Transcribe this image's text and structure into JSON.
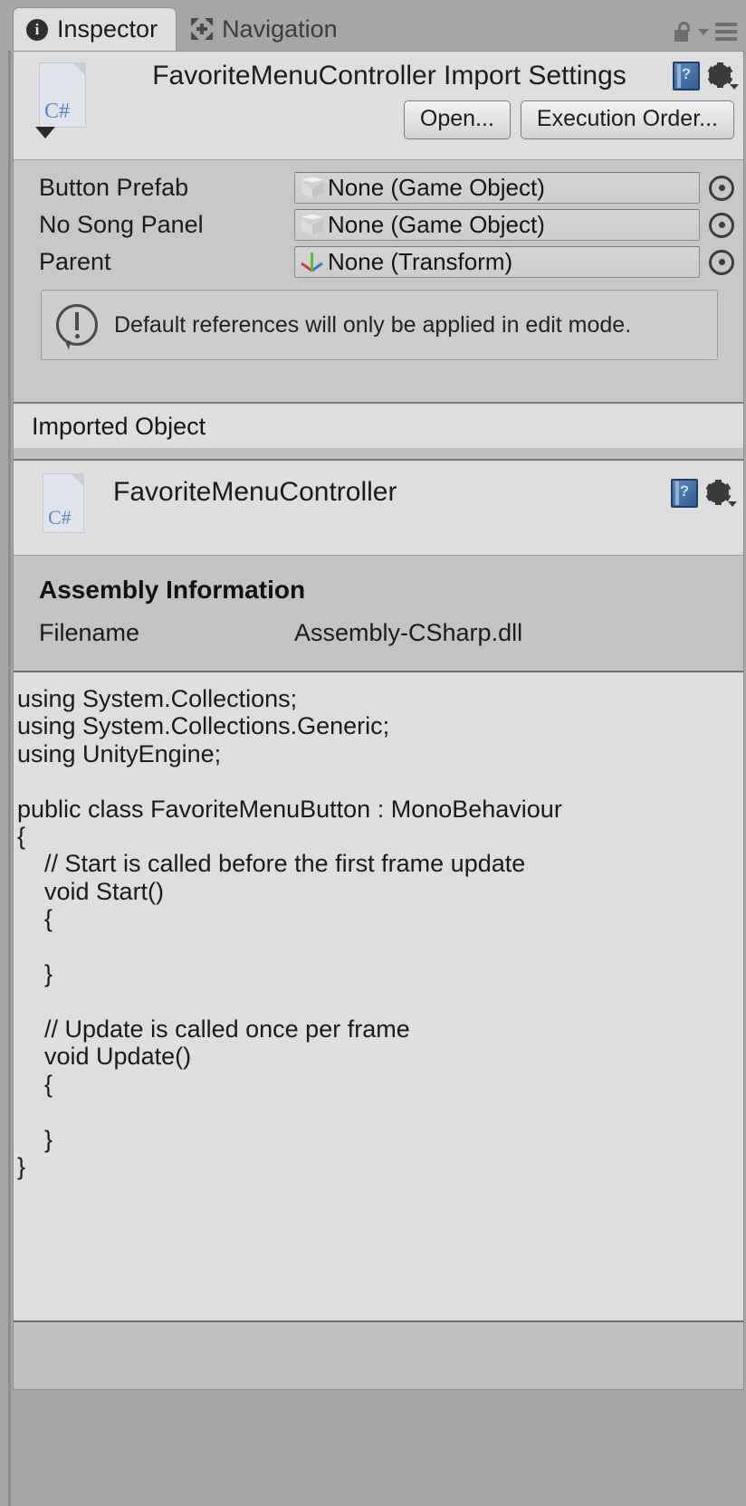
{
  "tabs": [
    {
      "label": "Inspector",
      "icon": "info-circle-icon",
      "active": true
    },
    {
      "label": "Navigation",
      "icon": "four-arrows-icon",
      "active": false
    }
  ],
  "window_controls": {
    "lock_icon": "lock-open-icon",
    "menu_caret_icon": "caret-down-icon",
    "menu_icon": "hamburger-menu-icon"
  },
  "import_settings": {
    "file_icon": "csharp-file-icon",
    "file_icon_label": "C#",
    "expand_caret_icon": "caret-down-icon",
    "title": "FavoriteMenuController Import Settings",
    "help_icon": "help-book-icon",
    "gear_icon": "gear-icon",
    "buttons": [
      {
        "label": "Open..."
      },
      {
        "label": "Execution Order..."
      }
    ]
  },
  "properties": [
    {
      "label": "Button Prefab",
      "value": "None (Game Object)",
      "value_icon": "game-object-cube-icon",
      "picker_icon": "circle-select-icon"
    },
    {
      "label": "No Song Panel",
      "value": "None (Game Object)",
      "value_icon": "game-object-cube-icon",
      "picker_icon": "circle-select-icon"
    },
    {
      "label": "Parent",
      "value": "None (Transform)",
      "value_icon": "transform-gizmo-icon",
      "picker_icon": "circle-select-icon"
    }
  ],
  "help_box": {
    "icon": "info-warning-icon",
    "message": "Default references will only be applied in edit mode."
  },
  "imported_object": {
    "section_title": "Imported Object",
    "file_icon": "csharp-file-icon",
    "file_icon_label": "C#",
    "name": "FavoriteMenuController",
    "help_icon": "help-book-icon",
    "gear_icon": "gear-icon"
  },
  "assembly_information": {
    "heading": "Assembly Information",
    "rows": [
      {
        "key": "Filename",
        "value": "Assembly-CSharp.dll"
      }
    ]
  },
  "code_preview": {
    "text": "using System.Collections;\nusing System.Collections.Generic;\nusing UnityEngine;\n\npublic class FavoriteMenuButton : MonoBehaviour\n{\n    // Start is called before the first frame update\n    void Start()\n    {\n        \n    }\n\n    // Update is called once per frame\n    void Update()\n    {\n        \n    }\n}"
  },
  "colors": {
    "window_bg": "#a5a5a5",
    "panel_bg": "#c8c8c8",
    "header_bg": "#dedede",
    "code_bg": "#dedede",
    "text": "#1a1a1a",
    "csharp_blue": "#5c84c8",
    "axis_green": "#57c22e",
    "axis_red": "#d23b3b",
    "axis_blue": "#3b6fd2"
  }
}
